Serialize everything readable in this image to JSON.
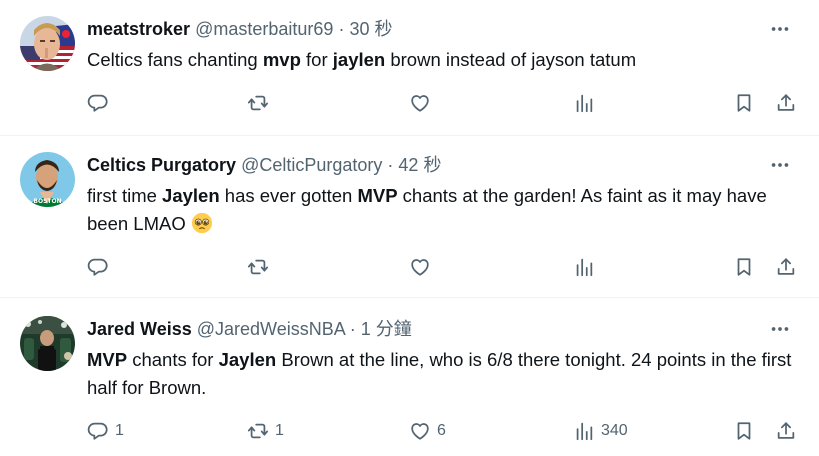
{
  "tweets": [
    {
      "name": "meatstroker",
      "handle": "@masterbaitur69",
      "separator": "·",
      "time": "30 秒",
      "text_parts": [
        "Celtics fans chanting ",
        "mvp",
        " for ",
        "jaylen",
        " brown instead of jayson tatum"
      ],
      "replies": "",
      "retweets": "",
      "likes": "",
      "views": ""
    },
    {
      "name": "Celtics Purgatory",
      "handle": "@CelticPurgatory",
      "separator": "·",
      "time": "42 秒",
      "text_parts": [
        "first time ",
        "Jaylen",
        " has ever gotten ",
        "MVP",
        " chants at the garden!  As faint as it may have been LMAO "
      ],
      "emoji": "pleading-face-emoji",
      "replies": "",
      "retweets": "",
      "likes": "",
      "views": ""
    },
    {
      "name": "Jared Weiss",
      "handle": "@JaredWeissNBA",
      "separator": "·",
      "time": "1 分鐘",
      "text_parts": [
        "MVP",
        " chants for ",
        "Jaylen",
        " Brown at the line, who is 6/8 there tonight. 24 points in the first half for Brown."
      ],
      "replies": "1",
      "retweets": "1",
      "likes": "6",
      "views": "340"
    }
  ],
  "icons": {
    "more": "more-icon",
    "reply": "reply-icon",
    "retweet": "retweet-icon",
    "like": "like-icon",
    "views": "views-icon",
    "bookmark": "bookmark-icon",
    "share": "share-icon"
  },
  "colors": {
    "text": "#0f1419",
    "secondary": "#536471",
    "divider": "#eff3f4",
    "celtics_green": "#007a33"
  }
}
